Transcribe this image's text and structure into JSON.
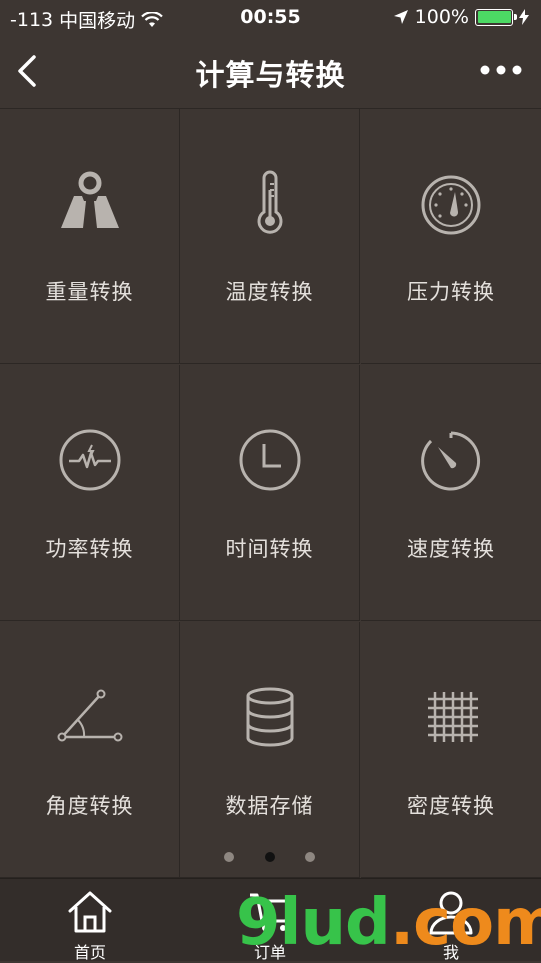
{
  "status_bar": {
    "signal": "-113",
    "carrier": "中国移动",
    "time": "00:55",
    "battery": "100%",
    "battery_color": "#4cd964"
  },
  "nav": {
    "title": "计算与转换",
    "back_icon": "chevron-left-icon",
    "more_icon": "more-dots-icon"
  },
  "tiles": [
    {
      "label": "重量转换",
      "icon": "weight-icon"
    },
    {
      "label": "温度转换",
      "icon": "thermometer-icon"
    },
    {
      "label": "压力转换",
      "icon": "pressure-gauge-icon"
    },
    {
      "label": "功率转换",
      "icon": "power-pulse-icon"
    },
    {
      "label": "时间转换",
      "icon": "clock-icon"
    },
    {
      "label": "速度转换",
      "icon": "speedometer-icon"
    },
    {
      "label": "角度转换",
      "icon": "angle-icon"
    },
    {
      "label": "数据存储",
      "icon": "database-icon"
    },
    {
      "label": "密度转换",
      "icon": "grid-density-icon"
    }
  ],
  "pagination": {
    "pages": 3,
    "active": 2
  },
  "tab_bar": {
    "items": [
      {
        "label": "首页",
        "icon": "home-icon"
      },
      {
        "label": "订单",
        "icon": "cart-icon"
      },
      {
        "label": "我",
        "icon": "user-icon"
      }
    ]
  },
  "watermark": {
    "text_9": "9",
    "text_lud": "lud",
    "text_dot": ".",
    "text_com": "com",
    "color_green": "#37c34a",
    "color_orange": "#ee8a1c"
  }
}
